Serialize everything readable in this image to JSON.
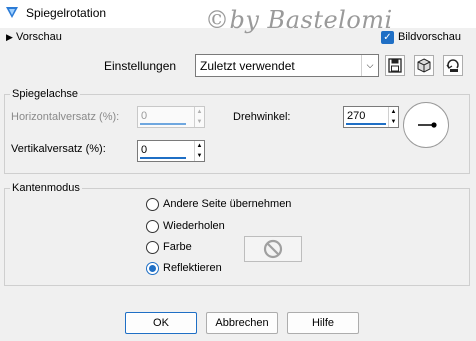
{
  "window": {
    "title": "Spiegelrotation",
    "watermark": "©by Bastelomi"
  },
  "header": {
    "preview_toggle": "Vorschau",
    "preview_checkbox": {
      "label": "Bildvorschau",
      "checked": true
    }
  },
  "settings": {
    "label": "Einstellungen",
    "selected": "Zuletzt verwendet"
  },
  "mirror_axis": {
    "title": "Spiegelachse",
    "horizontal_offset_label": "Horizontalversatz (%):",
    "horizontal_offset_value": "0",
    "vertical_offset_label": "Vertikalversatz (%):",
    "vertical_offset_value": "0",
    "rotation_angle_label": "Drehwinkel:",
    "rotation_angle_value": "270"
  },
  "edge_mode": {
    "title": "Kantenmodus",
    "options": [
      {
        "label": "Andere Seite übernehmen",
        "checked": false
      },
      {
        "label": "Wiederholen",
        "checked": false
      },
      {
        "label": "Farbe",
        "checked": false
      },
      {
        "label": "Reflektieren",
        "checked": true
      }
    ]
  },
  "buttons": {
    "ok": "OK",
    "cancel": "Abbrechen",
    "help": "Hilfe"
  },
  "colors": {
    "accent": "#1f6fc5",
    "background": "#f0f0f0"
  }
}
